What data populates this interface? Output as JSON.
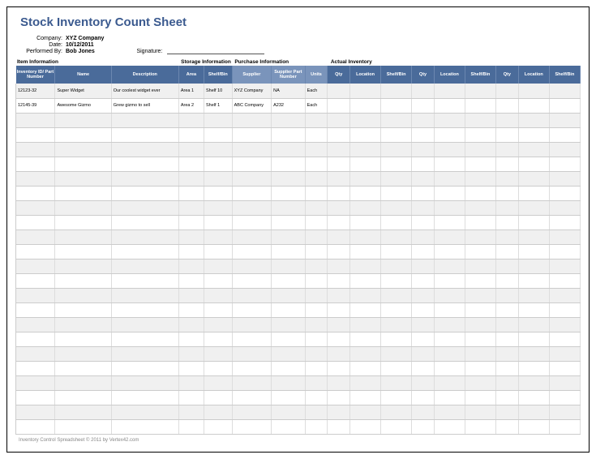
{
  "title": "Stock Inventory Count Sheet",
  "meta": {
    "company_label": "Company:",
    "company": "XYZ Company",
    "date_label": "Date:",
    "date": "10/12/2011",
    "performed_label": "Performed By:",
    "performed": "Bob Jones",
    "signature_label": "Signature:"
  },
  "groups": {
    "item": "Item Information",
    "storage": "Storage Information",
    "purchase": "Purchase Information",
    "actual": "Actual Inventory"
  },
  "headers": {
    "inv": "Inventory ID/ Part Number",
    "name": "Name",
    "desc": "Description",
    "area": "Area",
    "shelf": "Shelf/Bin",
    "supplier": "Supplier",
    "spn": "Supplier Part Number",
    "units": "Units",
    "qty": "Qty",
    "loc": "Location",
    "sb": "Shelf/Bin"
  },
  "rows": [
    {
      "inv": "12123-32",
      "name": "Super Widget",
      "desc": "Our coolest widget ever",
      "area": "Area 1",
      "shelf": "Shelf 10",
      "supplier": "XYZ Company",
      "spn": "NA",
      "units": "Each"
    },
    {
      "inv": "12145-39",
      "name": "Awesome Gizmo",
      "desc": "Grew gizmo to sell",
      "area": "Area 2",
      "shelf": "Shelf 1",
      "supplier": "ABC Company",
      "spn": "A232",
      "units": "Each"
    }
  ],
  "empty_rows": 22,
  "footer": "Inventory Control Spreadsheet © 2011 by Vertex42.com"
}
